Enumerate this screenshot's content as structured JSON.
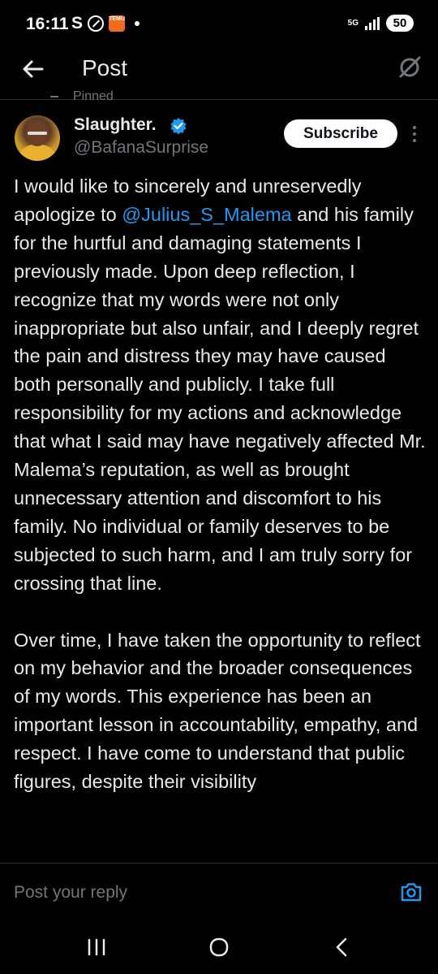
{
  "status_bar": {
    "time": "16:11",
    "s_icon": "S",
    "temu_icon_text": "TEMU",
    "network": "5G",
    "battery": "50"
  },
  "header": {
    "title": "Post",
    "back_icon": "arrow-left-icon",
    "grok_icon": "grok-slash-icon"
  },
  "post": {
    "pinned_label": "Pinned",
    "author": {
      "display_name": "Slaughter.",
      "handle": "@BafanaSurprise",
      "verified": true
    },
    "subscribe_label": "Subscribe",
    "body_start": "I would like to sincerely and unreservedly apologize to ",
    "mention": "@Julius_S_Malema",
    "body_rest": " and his family for the hurtful and damaging statements I previously made. Upon deep reflection, I recognize that my words were not only inappropriate but also unfair, and I deeply regret the pain and distress they may have caused both personally and publicly. I take full responsibility for my actions and acknowledge that what I said may have negatively affected Mr. Malema’s reputation, as well as brought unnecessary attention and discomfort to his family. No individual or family deserves to be subjected to such harm, and I am truly sorry for crossing that line.",
    "paragraph_2": "Over time, I have taken the opportunity to reflect on my behavior and the broader consequences of my words. This experience has been an important lesson in accountability, empathy, and respect. I have come to understand that public figures, despite their visibility"
  },
  "reply": {
    "placeholder": "Post your reply",
    "camera_icon": "camera-icon"
  },
  "nav": {
    "recent_icon": "recent-apps-icon",
    "home_icon": "home-icon",
    "back_icon": "back-chevron-icon"
  },
  "colors": {
    "background": "#000000",
    "text": "#e7e9ea",
    "muted": "#71767b",
    "accent": "#1d9bf0",
    "divider": "#2f3336"
  }
}
